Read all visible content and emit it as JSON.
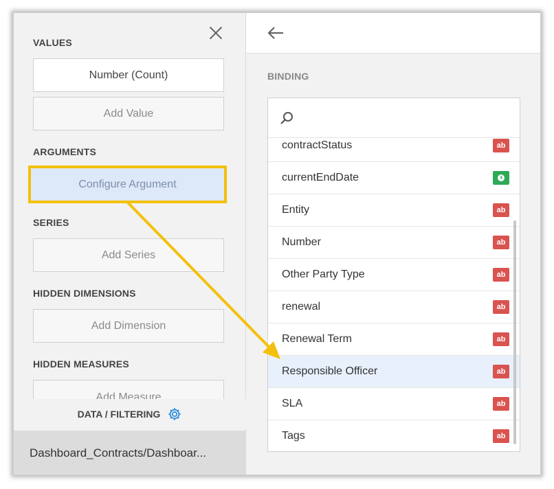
{
  "left_panel": {
    "values_label": "VALUES",
    "values_field": "Number (Count)",
    "add_value": "Add Value",
    "arguments_label": "ARGUMENTS",
    "configure_argument": "Configure Argument",
    "series_label": "SERIES",
    "add_series": "Add Series",
    "hidden_dimensions_label": "HIDDEN DIMENSIONS",
    "add_dimension": "Add Dimension",
    "hidden_measures_label": "HIDDEN MEASURES",
    "add_measure": "Add Measure",
    "data_filtering": "DATA / FILTERING",
    "dashboard_path": "Dashboard_Contracts/Dashboar..."
  },
  "right_panel": {
    "binding_label": "BINDING",
    "fields": [
      {
        "name": "contractStatus",
        "type": "ab"
      },
      {
        "name": "currentEndDate",
        "type": "date"
      },
      {
        "name": "Entity",
        "type": "ab"
      },
      {
        "name": "Number",
        "type": "ab"
      },
      {
        "name": "Other Party Type",
        "type": "ab"
      },
      {
        "name": "renewal",
        "type": "ab"
      },
      {
        "name": "Renewal Term",
        "type": "ab"
      },
      {
        "name": "Responsible Officer",
        "type": "ab",
        "selected": true
      },
      {
        "name": "SLA",
        "type": "ab"
      },
      {
        "name": "Tags",
        "type": "ab"
      }
    ]
  },
  "icons": {
    "close": "close-icon",
    "back": "arrow-left-icon",
    "search": "search-icon",
    "gear": "gear-icon",
    "date_type": "clock-icon",
    "string_type": "ab-text-type-icon"
  },
  "colors": {
    "highlight_border": "#f3c00d",
    "annotation_arrow": "#f3c00d",
    "string_badge": "#d9534f",
    "date_badge": "#2eaa57",
    "gear": "#2e8fde",
    "selected_row": "#e8f0fb"
  }
}
